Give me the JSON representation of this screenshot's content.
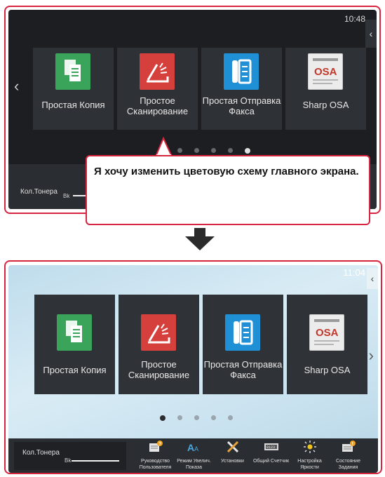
{
  "top_screen": {
    "clock": "10:48",
    "tiles": [
      {
        "label": "Простая Копия",
        "icon": "copy-icon"
      },
      {
        "label": "Простое Сканирование",
        "icon": "scan-icon"
      },
      {
        "label": "Простая Отправка Факса",
        "icon": "fax-icon"
      },
      {
        "label": "Sharp OSA",
        "icon": "sharp-osa-icon"
      }
    ],
    "toner_label": "Кол.Тонера",
    "toner_color": "Bk"
  },
  "callout": {
    "text": "Я хочу изменить цветовую схему главного экрана."
  },
  "bottom_screen": {
    "clock": "11:04",
    "tiles": [
      {
        "label": "Простая Копия",
        "icon": "copy-icon"
      },
      {
        "label": "Простое Сканирование",
        "icon": "scan-icon"
      },
      {
        "label": "Простая Отправка Факса",
        "icon": "fax-icon"
      },
      {
        "label": "Sharp OSA",
        "icon": "sharp-osa-icon"
      }
    ],
    "toner_label": "Кол.Тонера",
    "toner_color": "Bk",
    "functions": [
      {
        "label": "Руководство Пользователя",
        "icon": "user-guide-icon"
      },
      {
        "label": "Режим Увелич. Показа",
        "icon": "zoom-display-icon"
      },
      {
        "label": "Установки",
        "icon": "settings-tools-icon"
      },
      {
        "label": "Общий Счетчик",
        "icon": "counter-icon"
      },
      {
        "label": "Настройка Яркости",
        "icon": "brightness-icon"
      },
      {
        "label": "Состояние Задания",
        "icon": "job-status-icon"
      }
    ]
  },
  "colors": {
    "highlight": "#d7243f",
    "copy_tile": "#3aa55a",
    "scan_tile": "#d6403c",
    "fax_tile": "#1f8fd6"
  }
}
